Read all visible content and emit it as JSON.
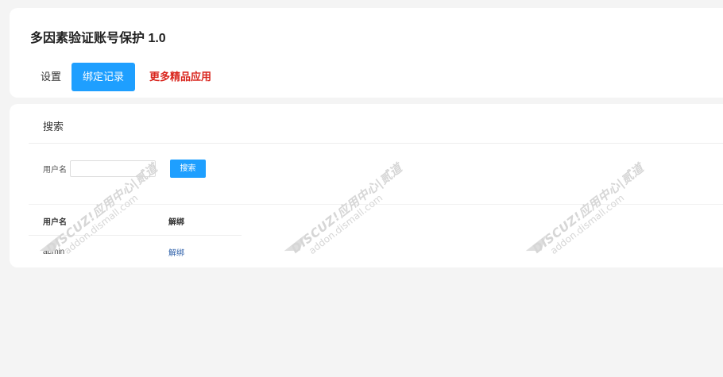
{
  "app": {
    "title": "多因素验证账号保护 1.0"
  },
  "tabs": [
    {
      "label": "设置",
      "active": false
    },
    {
      "label": "绑定记录",
      "active": true
    },
    {
      "label": "更多精品应用",
      "active": false,
      "color": "#d9251d"
    }
  ],
  "search_section": {
    "title": "搜索",
    "username_label": "用户名",
    "username_value": "",
    "username_placeholder": "",
    "search_button": "搜索"
  },
  "table": {
    "columns": [
      "用户名",
      "解绑"
    ],
    "rows": [
      {
        "username": "admin",
        "action": "解绑"
      }
    ]
  },
  "watermark": {
    "line1": "DISCUZ!应用中心|贰道",
    "line2": "addon.dismall.com"
  },
  "colors": {
    "primary": "#1e9fff",
    "promo": "#d9251d",
    "link": "#2b5ea8",
    "background": "#f4f4f4"
  }
}
